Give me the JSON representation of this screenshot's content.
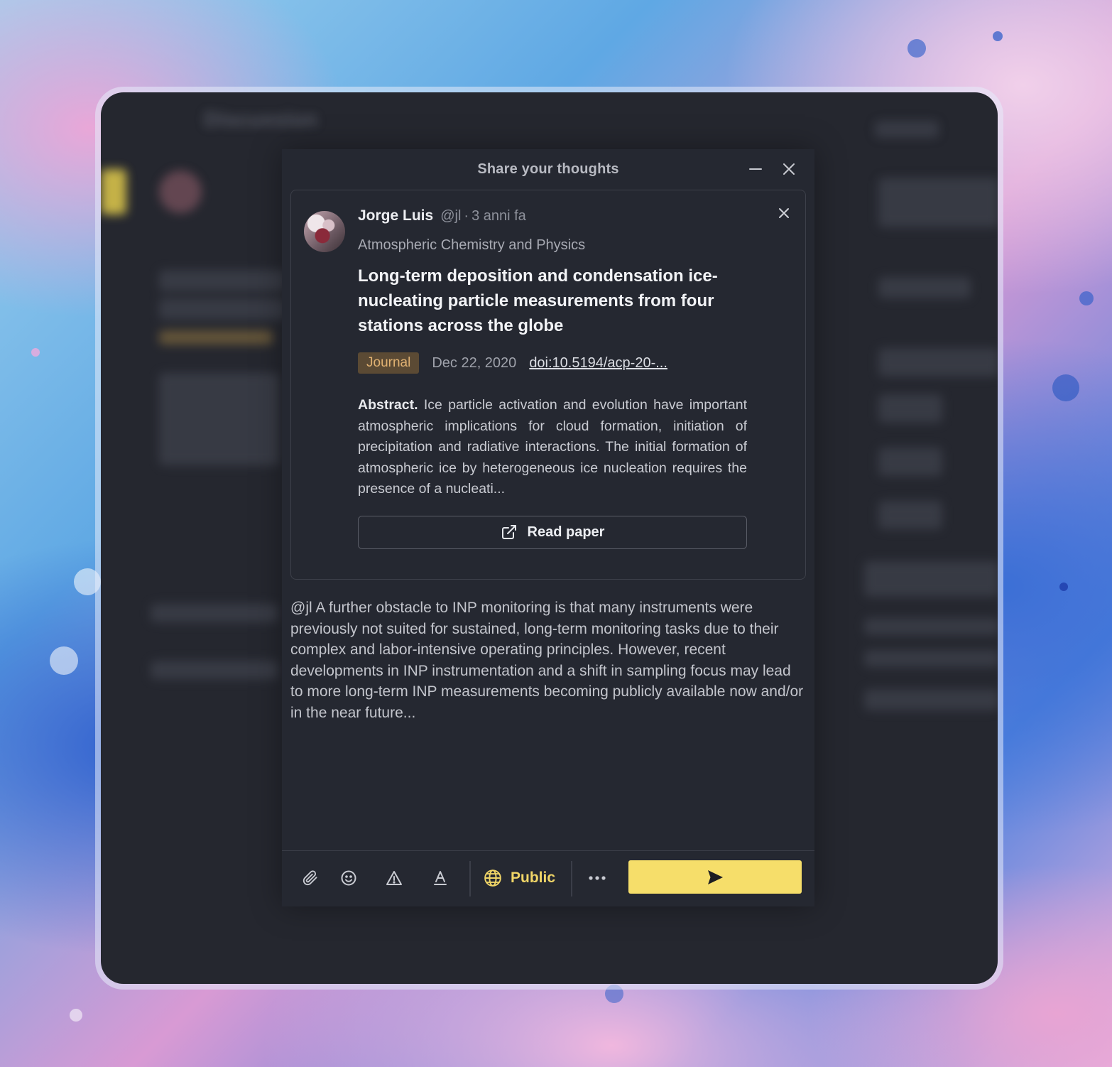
{
  "background_app": {
    "title": "Discussion"
  },
  "dialog": {
    "title": "Share your thoughts",
    "minimize_icon": "minus-icon",
    "close_icon": "close-icon"
  },
  "quoted_post": {
    "author_name": "Jorge Luis",
    "author_handle": "@jl",
    "separator": "·",
    "time_ago": "3 anni fa",
    "journal": "Atmospheric Chemistry and Physics",
    "paper_title": "Long-term deposition and condensation ice-nucleating particle measurements from four stations across the globe",
    "type_badge": "Journal",
    "date": "Dec 22, 2020",
    "doi": "doi:10.5194/acp-20-...",
    "abstract_label": "Abstract.",
    "abstract_text": "Ice particle activation and evolution have important atmospheric implications for cloud formation, initiation of precipitation and radiative interactions. The initial formation of atmospheric ice by heterogeneous ice nucleation requires the presence of a nucleati...",
    "read_button": "Read paper",
    "read_icon": "external-link-icon",
    "remove_icon": "close-icon"
  },
  "composer": {
    "text": "@jl A further obstacle to INP monitoring is that many instruments were previously not suited for sustained, long-term monitoring tasks due to their complex and labor-intensive operating principles. However, recent developments in INP instrumentation and a shift in sampling focus may lead to more long-term INP measurements becoming publicly available now and/or in the near future..."
  },
  "toolbar": {
    "icons": [
      "paperclip-icon",
      "emoji-icon",
      "warning-icon",
      "text-format-icon",
      "more-icon",
      "send-icon"
    ],
    "visibility_label": "Public",
    "visibility_icon": "globe-icon"
  },
  "colors": {
    "accent": "#f6de6a",
    "badge_bg": "#5b4a34",
    "badge_text": "#e0b172",
    "surface": "#252831"
  }
}
